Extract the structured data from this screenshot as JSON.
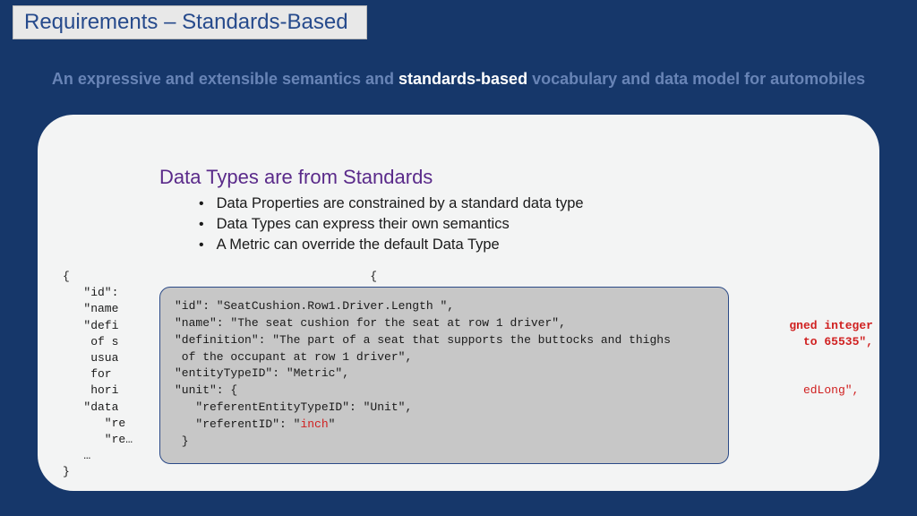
{
  "title": "Requirements – Standards-Based",
  "subtitle": {
    "prefix": "An expressive and extensible semantics and ",
    "bold": "standards-based",
    "suffix": " vocabulary and data model for automobiles"
  },
  "section_title": "Data Types are from Standards",
  "bullets": [
    "Data Properties are constrained by a standard data type",
    "Data Types can express their own semantics",
    "A Metric can override the default Data Type"
  ],
  "code_bg": {
    "l1": "{                                           {",
    "l2": "   \"id\":",
    "l3": "   \"name",
    "l4": "   \"defi",
    "l4r1": "gned integer",
    "l5": "    of s",
    "l5r1": " to 65535\",",
    "l6": "    usua",
    "l7": "    for",
    "l8": "    hori",
    "l8r1": "edLong\",",
    "l9": "   \"data",
    "l10": "      \"re",
    "l11": "      \"re…",
    "l12": "   …",
    "l13": "}"
  },
  "popup": {
    "p1": "\"id\": \"SeatCushion.Row1.Driver.Length \",",
    "p2": "\"name\": \"The seat cushion for the seat at row 1 driver\",",
    "p3": "\"definition\": \"The part of a seat that supports the buttocks and thighs",
    "p4": " of the occupant at row 1 driver\",",
    "p5": "\"entityTypeID\": \"Metric\",",
    "p6": "\"unit\": {",
    "p7": "   \"referentEntityTypeID\": \"Unit\",",
    "p8a": "   \"referentID\": \"",
    "p8b": "inch",
    "p8c": "\"",
    "p9": " }"
  }
}
